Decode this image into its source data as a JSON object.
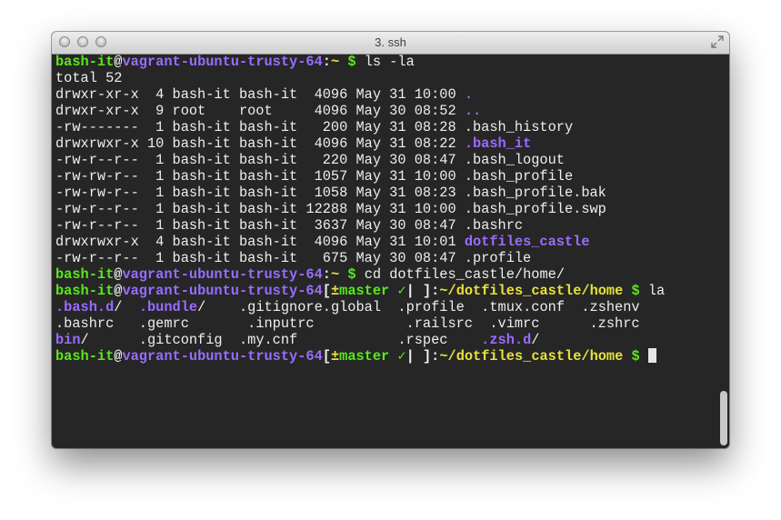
{
  "window": {
    "title": "3. ssh"
  },
  "terminal": {
    "lines": [
      [
        {
          "t": "bash-it",
          "c": "g"
        },
        {
          "t": "@",
          "c": "w"
        },
        {
          "t": "vagrant-ubuntu-trusty-64",
          "c": "p"
        },
        {
          "t": ":",
          "c": "w"
        },
        {
          "t": "~",
          "c": "y"
        },
        {
          "t": " $ ",
          "c": "g"
        },
        {
          "t": "ls -la",
          "c": "n"
        }
      ],
      [
        {
          "t": "total 52",
          "c": "n"
        }
      ],
      [
        {
          "t": "drwxr-xr-x  4 bash-it bash-it  4096 May 31 10:00 ",
          "c": "n"
        },
        {
          "t": ".",
          "c": "p"
        }
      ],
      [
        {
          "t": "drwxr-xr-x  9 root    root     4096 May 30 08:52 ",
          "c": "n"
        },
        {
          "t": "..",
          "c": "p"
        }
      ],
      [
        {
          "t": "-rw-------  1 bash-it bash-it   200 May 31 08:28 .bash_history",
          "c": "n"
        }
      ],
      [
        {
          "t": "drwxrwxr-x 10 bash-it bash-it  4096 May 31 08:22 ",
          "c": "n"
        },
        {
          "t": ".bash_it",
          "c": "p"
        }
      ],
      [
        {
          "t": "-rw-r--r--  1 bash-it bash-it   220 May 30 08:47 .bash_logout",
          "c": "n"
        }
      ],
      [
        {
          "t": "-rw-rw-r--  1 bash-it bash-it  1057 May 31 10:00 .bash_profile",
          "c": "n"
        }
      ],
      [
        {
          "t": "-rw-rw-r--  1 bash-it bash-it  1058 May 31 08:23 .bash_profile.bak",
          "c": "n"
        }
      ],
      [
        {
          "t": "-rw-r--r--  1 bash-it bash-it 12288 May 31 10:00 .bash_profile.swp",
          "c": "n"
        }
      ],
      [
        {
          "t": "-rw-r--r--  1 bash-it bash-it  3637 May 30 08:47 .bashrc",
          "c": "n"
        }
      ],
      [
        {
          "t": "drwxrwxr-x  4 bash-it bash-it  4096 May 31 10:01 ",
          "c": "n"
        },
        {
          "t": "dotfiles_castle",
          "c": "p"
        }
      ],
      [
        {
          "t": "-rw-r--r--  1 bash-it bash-it   675 May 30 08:47 .profile",
          "c": "n"
        }
      ],
      [
        {
          "t": "bash-it",
          "c": "g"
        },
        {
          "t": "@",
          "c": "w"
        },
        {
          "t": "vagrant-ubuntu-trusty-64",
          "c": "p"
        },
        {
          "t": ":",
          "c": "w"
        },
        {
          "t": "~",
          "c": "y"
        },
        {
          "t": " $ ",
          "c": "g"
        },
        {
          "t": "cd dotfiles_castle/home/",
          "c": "n"
        }
      ],
      [
        {
          "t": "bash-it",
          "c": "g"
        },
        {
          "t": "@",
          "c": "w"
        },
        {
          "t": "vagrant-ubuntu-trusty-64",
          "c": "p"
        },
        {
          "t": "[",
          "c": "w"
        },
        {
          "t": "±",
          "c": "y"
        },
        {
          "t": "master ",
          "c": "g"
        },
        {
          "t": "✓",
          "c": "g"
        },
        {
          "t": "| ",
          "c": "w"
        },
        {
          "t": "]:",
          "c": "w"
        },
        {
          "t": "~/dotfiles_castle/home",
          "c": "y"
        },
        {
          "t": " $ ",
          "c": "g"
        },
        {
          "t": "la",
          "c": "n"
        }
      ],
      [
        {
          "t": ".bash.d",
          "c": "p"
        },
        {
          "t": "/  ",
          "c": "n"
        },
        {
          "t": ".bundle",
          "c": "p"
        },
        {
          "t": "/    .gitignore.global  .profile  .tmux.conf  .zshenv",
          "c": "n"
        }
      ],
      [
        {
          "t": ".bashrc   .gemrc       .inputrc           .railsrc  .vimrc      .zshrc",
          "c": "n"
        }
      ],
      [
        {
          "t": "bin",
          "c": "p"
        },
        {
          "t": "/      .gitconfig  .my.cnf            .rspec    ",
          "c": "n"
        },
        {
          "t": ".zsh.d",
          "c": "p"
        },
        {
          "t": "/",
          "c": "n"
        }
      ],
      [
        {
          "t": "bash-it",
          "c": "g"
        },
        {
          "t": "@",
          "c": "w"
        },
        {
          "t": "vagrant-ubuntu-trusty-64",
          "c": "p"
        },
        {
          "t": "[",
          "c": "w"
        },
        {
          "t": "±",
          "c": "y"
        },
        {
          "t": "master ",
          "c": "g"
        },
        {
          "t": "✓",
          "c": "g"
        },
        {
          "t": "| ",
          "c": "w"
        },
        {
          "t": "]:",
          "c": "w"
        },
        {
          "t": "~/dotfiles_castle/home",
          "c": "y"
        },
        {
          "t": " $ ",
          "c": "g"
        }
      ]
    ]
  },
  "colors": {
    "terminal_bg": "#262626",
    "green": "#59e81b",
    "purple": "#9a6cff",
    "yellow": "#e8e13a"
  },
  "icons": {
    "traffic_lights": [
      "close-button",
      "minimize-button",
      "zoom-button"
    ],
    "fullscreen": "fullscreen-icon"
  }
}
